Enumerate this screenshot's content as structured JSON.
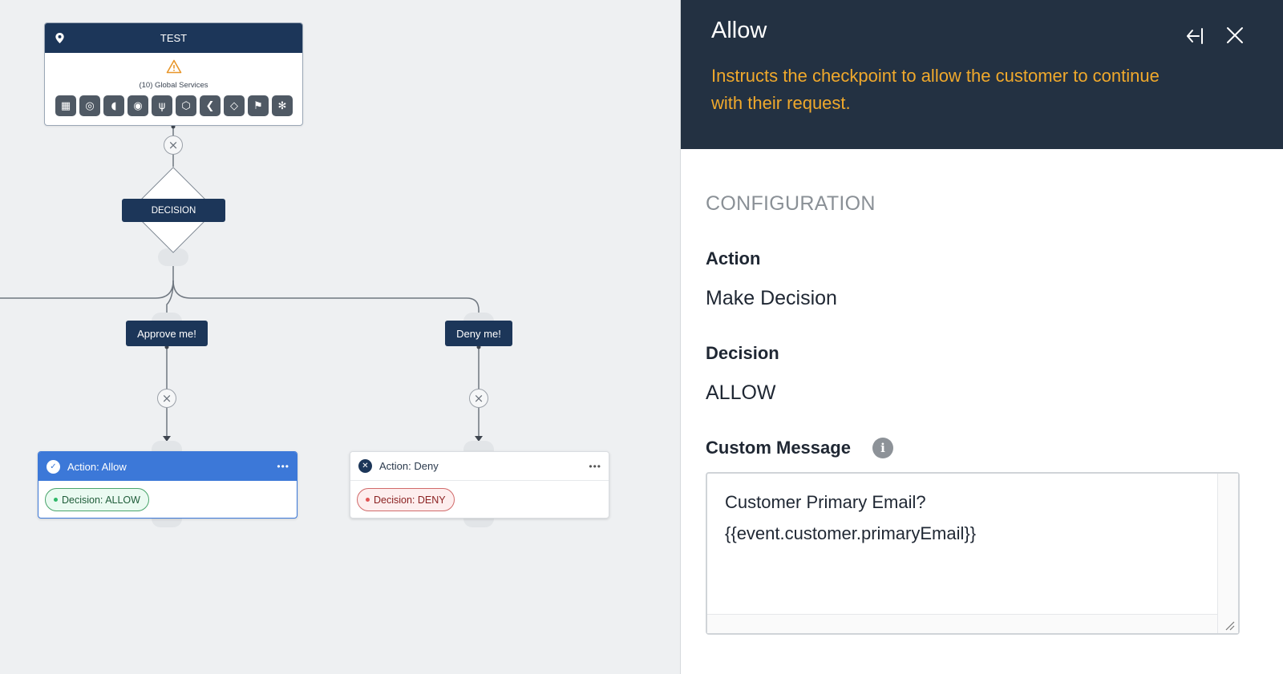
{
  "canvas": {
    "trigger_node": {
      "title": "TEST",
      "global_services_label": "(10) Global Services",
      "services": [
        "grid-icon",
        "swirl-icon",
        "shield-leaf-icon",
        "fingerprint-icon",
        "sprout-icon",
        "hexagon-layers-icon",
        "chevron-left-icon",
        "diamond-arrows-icon",
        "flag-icon",
        "gear-snowflake-icon"
      ]
    },
    "decision_node": {
      "label": "DECISION"
    },
    "paths": [
      {
        "label": "Approve me!"
      },
      {
        "label": "Deny me!"
      }
    ],
    "actions": [
      {
        "title": "Action: Allow",
        "decision": "Decision: ALLOW",
        "status": "selected"
      },
      {
        "title": "Action: Deny",
        "decision": "Decision: DENY",
        "status": "unselected"
      }
    ]
  },
  "panel": {
    "title": "Allow",
    "description": "Instructs the checkpoint to allow the customer to continue with their request.",
    "section_title": "CONFIGURATION",
    "fields": [
      {
        "label": "Action",
        "value": "Make Decision"
      },
      {
        "label": "Decision",
        "value": "ALLOW"
      }
    ],
    "custom_message": {
      "label": "Custom Message",
      "value": "Customer Primary Email?\n{{event.customer.primaryEmail}}"
    }
  },
  "colors": {
    "navy": "#1c3659",
    "panel_header": "#233142",
    "accent_orange": "#f0a92c",
    "allow_blue": "#3c78d8",
    "allow_green": "#2fb868",
    "deny_red": "#e05353"
  }
}
